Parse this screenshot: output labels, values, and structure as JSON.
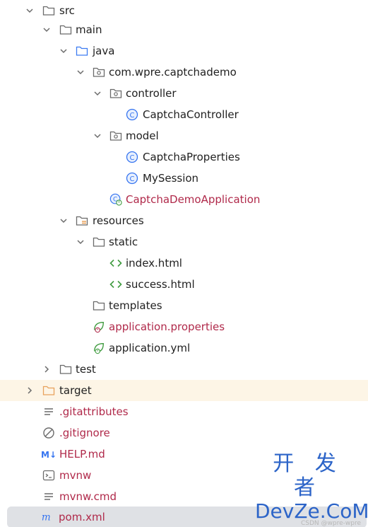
{
  "tree": {
    "src": "src",
    "main": "main",
    "java": "java",
    "package": "com.wpre.captchademo",
    "controller": "controller",
    "captcha_controller": "CaptchaController",
    "model": "model",
    "captcha_properties": "CaptchaProperties",
    "my_session": "MySession",
    "demo_application": "CaptchaDemoApplication",
    "resources": "resources",
    "static": "static",
    "index_html": "index.html",
    "success_html": "success.html",
    "templates": "templates",
    "app_properties": "application.properties",
    "app_yml": "application.yml",
    "test": "test",
    "target": "target",
    "gitattributes": ".gitattributes",
    "gitignore": ".gitignore",
    "help_md": "HELP.md",
    "mvnw": "mvnw",
    "mvnw_cmd": "mvnw.cmd",
    "pom_xml": "pom.xml"
  },
  "watermark": {
    "cn": "开 发 者",
    "en": "DevZe.CoM",
    "small": "CSDN @wpre-wpre"
  },
  "colors": {
    "modified_file": "#b0294a",
    "folder_blue": "#3d7cf2",
    "class_blue": "#3574f0",
    "spring_green": "#3f9b3f",
    "target_orange": "#e8a25c",
    "target_row_bg": "#fdf5e6",
    "selected_row_bg": "#dfe1e5"
  },
  "icons": {
    "folder": "folder-icon",
    "source_root": "source-folder-icon",
    "package": "package-icon",
    "class": "class-icon",
    "spring_boot": "spring-boot-icon",
    "resources": "resources-folder-icon",
    "html": "html-icon",
    "text": "text-file-icon",
    "ignore": "ignore-file-icon",
    "markdown": "markdown-icon",
    "terminal": "terminal-icon",
    "maven": "maven-icon"
  }
}
